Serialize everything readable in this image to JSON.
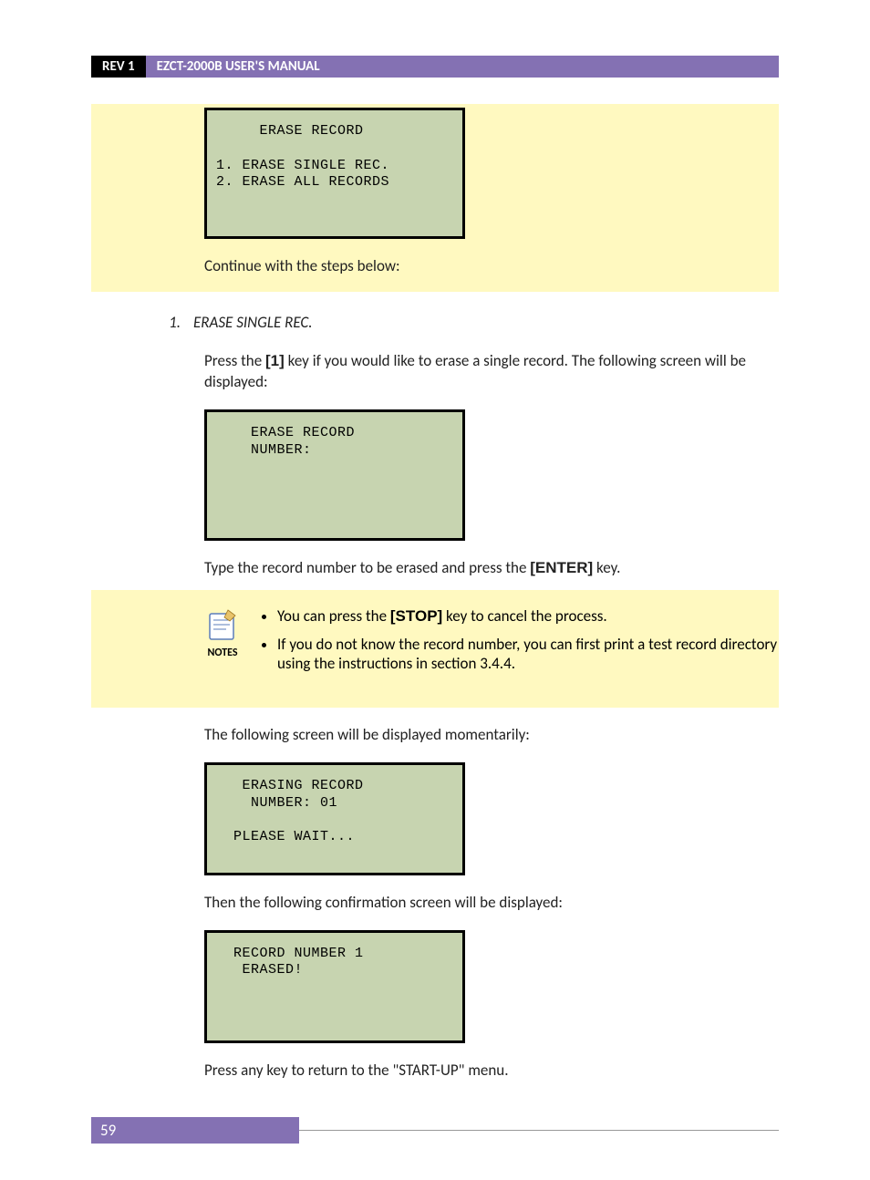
{
  "header": {
    "rev": "REV 1",
    "title": "EZCT-2000B USER'S MANUAL"
  },
  "lcd1": {
    "title": "     ERASE RECORD",
    "line1": "1. ERASE SINGLE REC.",
    "line2": "2. ERASE ALL RECORDS"
  },
  "continue_text": "Continue with the steps below:",
  "step1": {
    "num": "1.",
    "heading": "ERASE SINGLE REC.",
    "para1a": "Press the ",
    "key1": "[1]",
    "para1b": " key if you would like to erase a single record. The following screen will be displayed:"
  },
  "lcd2": {
    "line1": "    ERASE RECORD",
    "line2": "    NUMBER:"
  },
  "type_record_a": "Type the record number to be erased and press the ",
  "key_enter": "[ENTER]",
  "type_record_b": " key.",
  "notes_label": "NOTES",
  "note1a": "You can press the ",
  "key_stop": "[STOP]",
  "note1b": " key to cancel the process.",
  "note2": "If you do not know the record number, you can first print a test record directory using the instructions in section 3.4.4.",
  "moment_text": "The following screen will be displayed momentarily:",
  "lcd3": {
    "line1": "   ERASING RECORD",
    "line2": "    NUMBER: 01",
    "line3": "  PLEASE WAIT..."
  },
  "confirm_text": "Then the following confirmation screen will be displayed:",
  "lcd4": {
    "line1": "  RECORD NUMBER 1",
    "line2": "   ERASED!"
  },
  "press_any": "Press any key to return to the \"START-UP\" menu.",
  "page_num": "59"
}
